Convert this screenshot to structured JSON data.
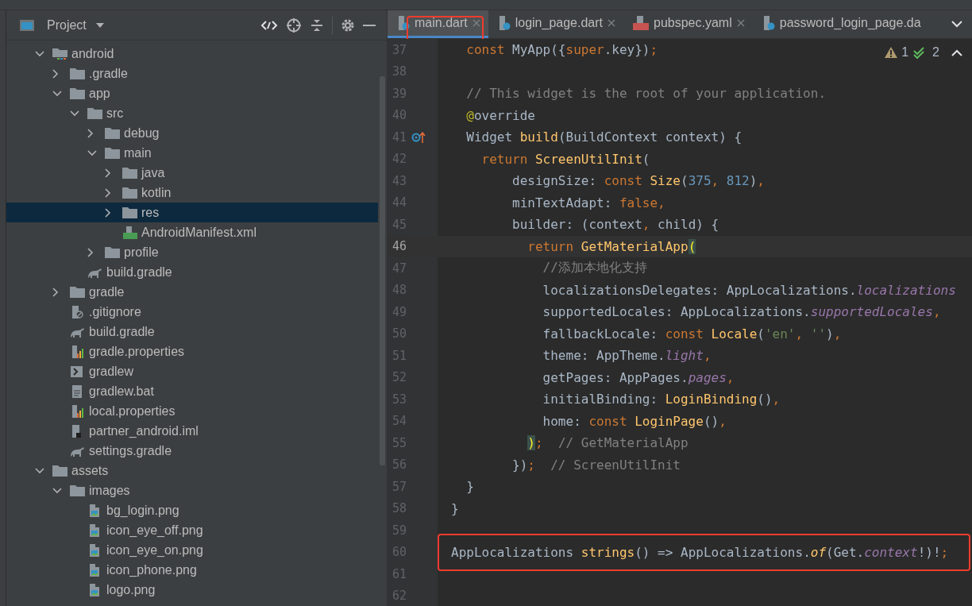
{
  "project": {
    "title": "Project",
    "tree": [
      {
        "name": "android",
        "kind": "module",
        "expanded": true,
        "selected": false,
        "children": [
          {
            "name": ".gradle",
            "kind": "folder",
            "expanded": false,
            "selected": false
          },
          {
            "name": "app",
            "kind": "folder",
            "expanded": true,
            "selected": false,
            "children": [
              {
                "name": "src",
                "kind": "folder",
                "expanded": true,
                "selected": false,
                "children": [
                  {
                    "name": "debug",
                    "kind": "folder",
                    "expanded": false,
                    "selected": false
                  },
                  {
                    "name": "main",
                    "kind": "folder",
                    "expanded": true,
                    "selected": false,
                    "children": [
                      {
                        "name": "java",
                        "kind": "folder",
                        "expanded": false,
                        "selected": false
                      },
                      {
                        "name": "kotlin",
                        "kind": "folder",
                        "expanded": false,
                        "selected": false
                      },
                      {
                        "name": "res",
                        "kind": "folder",
                        "expanded": false,
                        "selected": true
                      },
                      {
                        "name": "AndroidManifest.xml",
                        "kind": "manifest",
                        "selected": false
                      }
                    ]
                  },
                  {
                    "name": "profile",
                    "kind": "folder",
                    "expanded": false,
                    "selected": false
                  }
                ]
              },
              {
                "name": "build.gradle",
                "kind": "gradle",
                "selected": false
              }
            ]
          },
          {
            "name": "gradle",
            "kind": "folder",
            "expanded": false,
            "selected": false
          },
          {
            "name": ".gitignore",
            "kind": "ignore",
            "selected": false
          },
          {
            "name": "build.gradle",
            "kind": "gradle",
            "selected": false
          },
          {
            "name": "gradle.properties",
            "kind": "properties",
            "selected": false
          },
          {
            "name": "gradlew",
            "kind": "script",
            "selected": false
          },
          {
            "name": "gradlew.bat",
            "kind": "text",
            "selected": false
          },
          {
            "name": "local.properties",
            "kind": "properties",
            "selected": false
          },
          {
            "name": "partner_android.iml",
            "kind": "iml",
            "selected": false
          },
          {
            "name": "settings.gradle",
            "kind": "gradle",
            "selected": false
          }
        ]
      },
      {
        "name": "assets",
        "kind": "folder",
        "expanded": true,
        "selected": false,
        "children": [
          {
            "name": "images",
            "kind": "folder",
            "expanded": true,
            "selected": false,
            "children": [
              {
                "name": "bg_login.png",
                "kind": "image",
                "selected": false
              },
              {
                "name": "icon_eye_off.png",
                "kind": "image",
                "selected": false
              },
              {
                "name": "icon_eye_on.png",
                "kind": "image",
                "selected": false
              },
              {
                "name": "icon_phone.png",
                "kind": "image",
                "selected": false
              },
              {
                "name": "logo.png",
                "kind": "image",
                "selected": false
              }
            ]
          }
        ]
      }
    ]
  },
  "editor": {
    "tabs": [
      {
        "label": "main.dart",
        "kind": "dart",
        "selected": true,
        "highlighted": true,
        "closable": true
      },
      {
        "label": "login_page.dart",
        "kind": "dart",
        "selected": false,
        "highlighted": false,
        "closable": true
      },
      {
        "label": "pubspec.yaml",
        "kind": "yaml",
        "selected": false,
        "highlighted": false,
        "closable": true
      },
      {
        "label": "password_login_page.da",
        "kind": "dart",
        "selected": false,
        "highlighted": false,
        "closable": false
      }
    ],
    "warnings": "1",
    "weak_warnings": "2",
    "lines": [
      {
        "number": "37",
        "current": false,
        "highlighted": false,
        "tokens": [
          {
            "text": "  const ",
            "kind": "keyword"
          },
          {
            "text": "MyApp({",
            "kind": "plain"
          },
          {
            "text": "super",
            "kind": "keyword"
          },
          {
            "text": ".key})",
            "kind": "plain"
          },
          {
            "text": ";",
            "kind": "keyword"
          }
        ]
      },
      {
        "number": "38",
        "current": false,
        "highlighted": false
      },
      {
        "number": "39",
        "current": false,
        "highlighted": false,
        "tokens": [
          {
            "text": "  // This widget is the root of your application.",
            "kind": "comment"
          }
        ]
      },
      {
        "number": "40",
        "current": false,
        "highlighted": false,
        "tokens": [
          {
            "text": "  @",
            "kind": "annotation"
          },
          {
            "text": "override",
            "kind": "plain"
          }
        ]
      },
      {
        "number": "41",
        "current": false,
        "highlighted": false,
        "override_marker": true,
        "tokens": [
          {
            "text": "  Widget ",
            "kind": "plain"
          },
          {
            "text": "build",
            "kind": "function"
          },
          {
            "text": "(BuildContext context) {",
            "kind": "plain"
          }
        ]
      },
      {
        "number": "42",
        "current": false,
        "highlighted": false,
        "tokens": [
          {
            "text": "    return ",
            "kind": "keyword"
          },
          {
            "text": "ScreenUtilInit",
            "kind": "function"
          },
          {
            "text": "(",
            "kind": "plain"
          }
        ]
      },
      {
        "number": "43",
        "current": false,
        "highlighted": false,
        "tokens": [
          {
            "text": "        designSize: ",
            "kind": "plain"
          },
          {
            "text": "const ",
            "kind": "keyword"
          },
          {
            "text": "Size",
            "kind": "function"
          },
          {
            "text": "(",
            "kind": "plain"
          },
          {
            "text": "375",
            "kind": "number"
          },
          {
            "text": ", ",
            "kind": "keyword"
          },
          {
            "text": "812",
            "kind": "number"
          },
          {
            "text": ")",
            "kind": "plain"
          },
          {
            "text": ",",
            "kind": "keyword"
          }
        ]
      },
      {
        "number": "44",
        "current": false,
        "highlighted": false,
        "tokens": [
          {
            "text": "        minTextAdapt: ",
            "kind": "plain"
          },
          {
            "text": "false,",
            "kind": "keyword"
          }
        ]
      },
      {
        "number": "45",
        "current": false,
        "highlighted": false,
        "tokens": [
          {
            "text": "        builder: (context",
            "kind": "plain"
          },
          {
            "text": ", ",
            "kind": "keyword"
          },
          {
            "text": "child) {",
            "kind": "plain"
          }
        ]
      },
      {
        "number": "46",
        "current": true,
        "highlighted": false,
        "tokens": [
          {
            "text": "          return ",
            "kind": "keyword"
          },
          {
            "text": "GetMaterialApp",
            "kind": "function"
          },
          {
            "text": "(",
            "kind": "bracket"
          }
        ]
      },
      {
        "number": "47",
        "current": false,
        "highlighted": false,
        "tokens": [
          {
            "text": "            //添加本地化支持",
            "kind": "comment"
          }
        ]
      },
      {
        "number": "48",
        "current": false,
        "highlighted": false,
        "tokens": [
          {
            "text": "            localizationsDelegates: AppLocalizations.",
            "kind": "plain"
          },
          {
            "text": "localizations",
            "kind": "static"
          }
        ]
      },
      {
        "number": "49",
        "current": false,
        "highlighted": false,
        "tokens": [
          {
            "text": "            supportedLocales: AppLocalizations.",
            "kind": "plain"
          },
          {
            "text": "supportedLocales",
            "kind": "static"
          },
          {
            "text": ",",
            "kind": "keyword"
          }
        ]
      },
      {
        "number": "50",
        "current": false,
        "highlighted": false,
        "tokens": [
          {
            "text": "            fallbackLocale: ",
            "kind": "plain"
          },
          {
            "text": "const ",
            "kind": "keyword"
          },
          {
            "text": "Locale",
            "kind": "function"
          },
          {
            "text": "(",
            "kind": "plain"
          },
          {
            "text": "'en'",
            "kind": "string"
          },
          {
            "text": ", ",
            "kind": "keyword"
          },
          {
            "text": "''",
            "kind": "string"
          },
          {
            "text": ")",
            "kind": "plain"
          },
          {
            "text": ",",
            "kind": "keyword"
          }
        ]
      },
      {
        "number": "51",
        "current": false,
        "highlighted": false,
        "tokens": [
          {
            "text": "            theme: AppTheme.",
            "kind": "plain"
          },
          {
            "text": "light",
            "kind": "static"
          },
          {
            "text": ",",
            "kind": "keyword"
          }
        ]
      },
      {
        "number": "52",
        "current": false,
        "highlighted": false,
        "tokens": [
          {
            "text": "            getPages: AppPages.",
            "kind": "plain"
          },
          {
            "text": "pages",
            "kind": "static"
          },
          {
            "text": ",",
            "kind": "keyword"
          }
        ]
      },
      {
        "number": "53",
        "current": false,
        "highlighted": false,
        "tokens": [
          {
            "text": "            initialBinding: ",
            "kind": "plain"
          },
          {
            "text": "LoginBinding",
            "kind": "function"
          },
          {
            "text": "()",
            "kind": "plain"
          },
          {
            "text": ",",
            "kind": "keyword"
          }
        ]
      },
      {
        "number": "54",
        "current": false,
        "highlighted": false,
        "tokens": [
          {
            "text": "            home: ",
            "kind": "plain"
          },
          {
            "text": "const ",
            "kind": "keyword"
          },
          {
            "text": "LoginPage",
            "kind": "function"
          },
          {
            "text": "()",
            "kind": "plain"
          },
          {
            "text": ",",
            "kind": "keyword"
          }
        ]
      },
      {
        "number": "55",
        "current": false,
        "highlighted": false,
        "tokens": [
          {
            "text": "          )",
            "kind": "bracket"
          },
          {
            "text": ";",
            "kind": "keyword"
          },
          {
            "text": "  // GetMaterialApp",
            "kind": "comment"
          }
        ]
      },
      {
        "number": "56",
        "current": false,
        "highlighted": false,
        "tokens": [
          {
            "text": "        })",
            "kind": "plain"
          },
          {
            "text": ";",
            "kind": "keyword"
          },
          {
            "text": "  // ScreenUtilInit",
            "kind": "comment"
          }
        ]
      },
      {
        "number": "57",
        "current": false,
        "highlighted": false,
        "tokens": [
          {
            "text": "  }",
            "kind": "plain"
          }
        ]
      },
      {
        "number": "58",
        "current": false,
        "highlighted": false,
        "tokens": [
          {
            "text": "}",
            "kind": "plain"
          }
        ]
      },
      {
        "number": "59",
        "current": false,
        "highlighted": false
      },
      {
        "number": "60",
        "current": false,
        "highlighted": true,
        "tokens": [
          {
            "text": "AppLocalizations ",
            "kind": "plain"
          },
          {
            "text": "strings",
            "kind": "function"
          },
          {
            "text": "() => AppLocalizations.",
            "kind": "plain"
          },
          {
            "text": "of",
            "kind": "static_call"
          },
          {
            "text": "(Get.",
            "kind": "plain"
          },
          {
            "text": "context",
            "kind": "static"
          },
          {
            "text": "!)!",
            "kind": "plain"
          },
          {
            "text": ";",
            "kind": "keyword"
          }
        ]
      },
      {
        "number": "61",
        "current": false,
        "highlighted": false
      },
      {
        "number": "62",
        "current": false,
        "highlighted": false
      }
    ]
  }
}
